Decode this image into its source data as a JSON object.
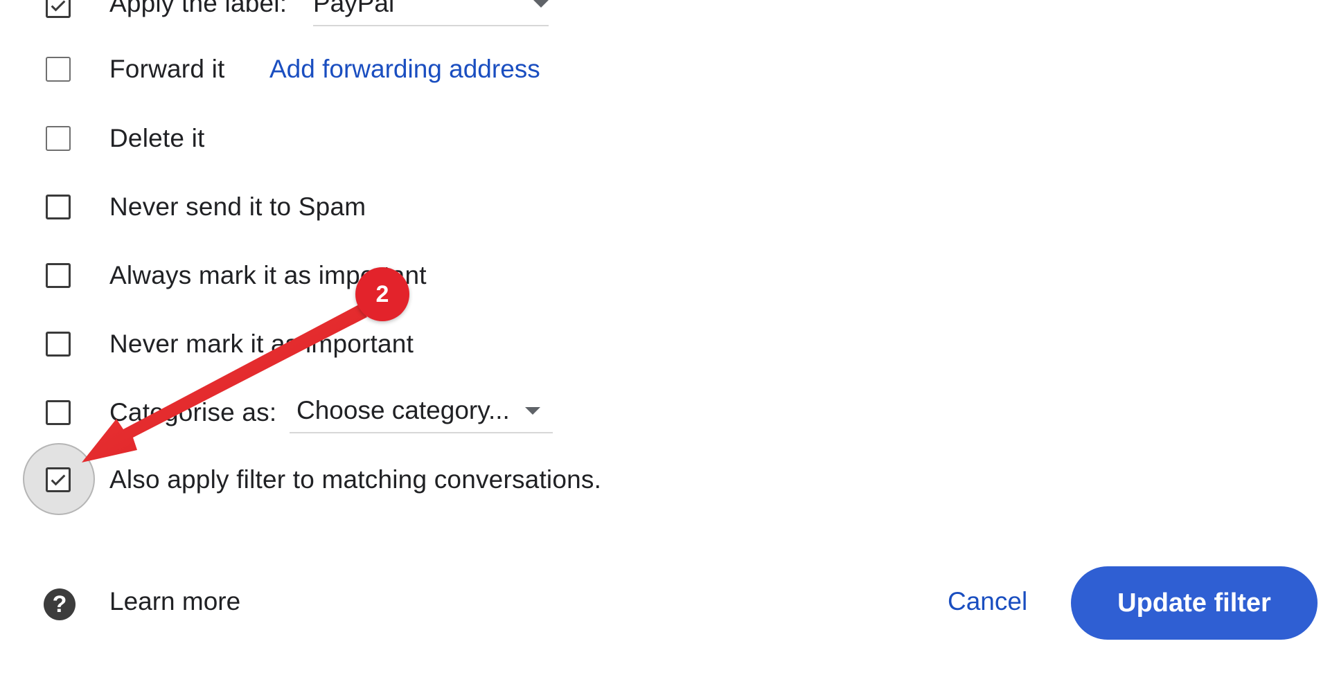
{
  "actions": {
    "apply_label": {
      "label": "Apply the label:",
      "value": "PayPal",
      "checked": true
    },
    "forward": {
      "label": "Forward it",
      "link": "Add forwarding address",
      "checked": false
    },
    "delete": {
      "label": "Delete it",
      "checked": false
    },
    "never_spam": {
      "label": "Never send it to Spam",
      "checked": false
    },
    "always_important": {
      "label": "Always mark it as important",
      "checked": false
    },
    "never_important": {
      "label": "Never mark it as important",
      "checked": false
    },
    "categorise": {
      "label": "Categorise as:",
      "value": "Choose category...",
      "checked": false
    },
    "also_apply": {
      "label": "Also apply filter to matching conversations.",
      "checked": true
    }
  },
  "footer": {
    "help_icon": "question-mark-icon",
    "learn_more": "Learn more",
    "cancel": "Cancel",
    "update": "Update filter"
  },
  "annotation": {
    "badge": "2",
    "color": "#e3232b"
  },
  "colors": {
    "link": "#1a4ec0",
    "primary_button": "#2f5fd3",
    "text": "#202124"
  }
}
